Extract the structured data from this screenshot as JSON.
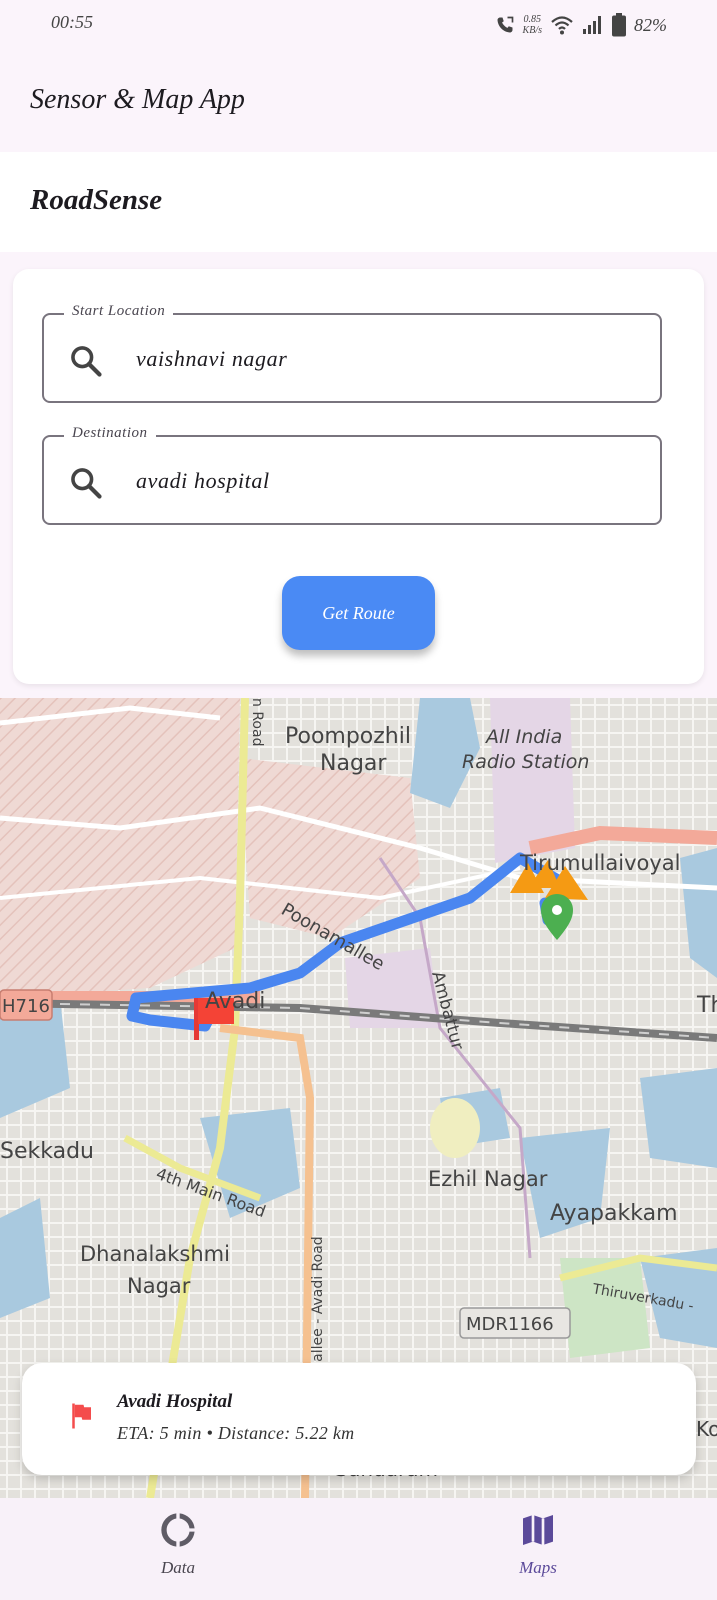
{
  "status_bar": {
    "time": "00:55",
    "speed_value": "0.85",
    "speed_unit": "KB/s",
    "battery": "82%"
  },
  "app_bar": {
    "title": "Sensor & Map App"
  },
  "subheader": {
    "title": "RoadSense"
  },
  "form": {
    "start": {
      "label": "Start Location",
      "value": "vaishnavi nagar"
    },
    "destination": {
      "label": "Destination",
      "value": "avadi hospital"
    },
    "button_label": "Get Route",
    "accent_color": "#4a8af4"
  },
  "map": {
    "labels": [
      "Poompozhil",
      "Nagar",
      "All India",
      "Radio Station",
      "Tirumullaivoyal",
      "Poonamallee",
      "Ambattur",
      "Avadi",
      "H716",
      "Th",
      "Sekkadu",
      "4th Main Road",
      "Ezhil Nagar",
      "Ayapakkam",
      "Dhanalakshmi",
      "Nagar",
      "Poonamallee - Avadi Road",
      "Thiruverkadu -",
      "MDR1166",
      "Sundaram",
      "Ko",
      "n Road"
    ],
    "route_color": "#4a86f0",
    "destination_marker": "red-flag-icon",
    "origin_marker": "green-pin-icon"
  },
  "route_info": {
    "destination": "Avadi Hospital",
    "details": "ETA: 5 min • Distance: 5.22 km"
  },
  "bottom_nav": {
    "items": [
      {
        "label": "Data",
        "icon": "donut-icon",
        "active": false
      },
      {
        "label": "Maps",
        "icon": "map-icon",
        "active": true
      }
    ],
    "active_color": "#5b4a9a"
  }
}
